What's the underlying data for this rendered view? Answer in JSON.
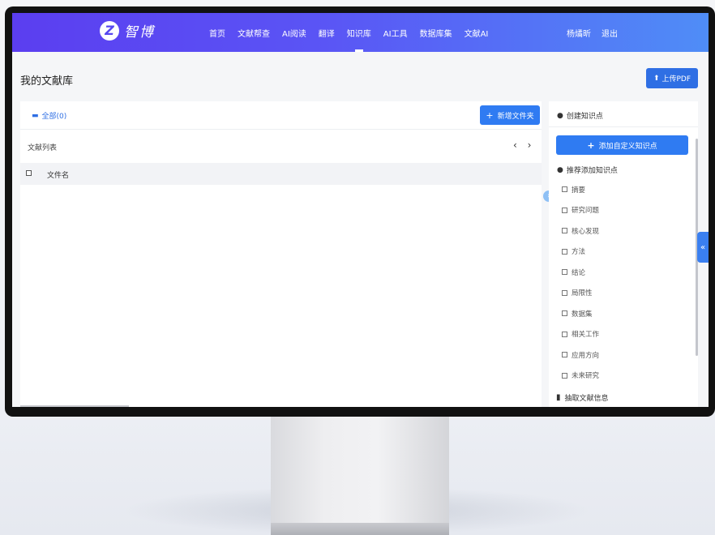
{
  "nav": {
    "logo_mark": "Z",
    "logo_text": "智博",
    "items": [
      {
        "label": "首页"
      },
      {
        "label": "文献帮查"
      },
      {
        "label": "AI阅读"
      },
      {
        "label": "翻译"
      },
      {
        "label": "知识库",
        "active": true
      },
      {
        "label": "AI工具"
      },
      {
        "label": "数据库集"
      },
      {
        "label": "文献AI"
      }
    ],
    "user_name": "杨燏昕",
    "logout": "退出",
    "gradient_colors": [
      "#5b3ef0",
      "#4f8df7"
    ]
  },
  "page": {
    "title": "我的文献库",
    "upload_button": "上传PDF"
  },
  "library": {
    "folder_all": "全部(0)",
    "new_folder_button": "新增文件夹",
    "list_title": "文献列表",
    "pager_prev": "‹",
    "pager_next": "›",
    "table_columns": [
      "文件名"
    ]
  },
  "knowledge": {
    "create_header": "创建知识点",
    "add_custom_button": "添加自定义知识点",
    "recommend_header": "推荐添加知识点",
    "recommend_items": [
      "摘要",
      "研究问题",
      "核心发现",
      "方法",
      "结论",
      "局限性",
      "数据集",
      "相关工作",
      "应用方向",
      "未来研究"
    ],
    "extract_label": "抽取文献信息"
  },
  "colors": {
    "primary": "#2f7bf2",
    "upload": "#2f6fe4"
  }
}
